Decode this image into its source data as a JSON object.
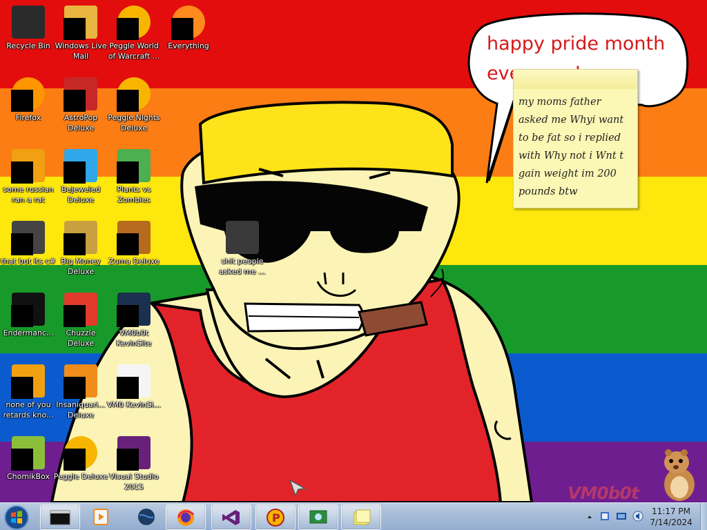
{
  "wallpaper": {
    "stripes": [
      "#e30d0d",
      "#fc7d14",
      "#fde70c",
      "#189a2a",
      "#0b5bcf",
      "#6e1e8e"
    ]
  },
  "speech_bubble": {
    "lines": [
      "happy pride month",
      "everyone!"
    ]
  },
  "sticky_note": {
    "lines": [
      "my moms father",
      "asked me Whyi want",
      "to be fat so i replied",
      "with Why not i Wnt t",
      "gain weight im 200",
      "pounds btw"
    ]
  },
  "desktop_icons": [
    {
      "label": "Recycle Bin",
      "icon": "recycle-bin-icon",
      "redacted": false
    },
    {
      "label": "Windows Live Mail",
      "icon": "mail-icon",
      "redacted": true
    },
    {
      "label": "Peggle World of Warcraft ...",
      "icon": "peggle-icon",
      "redacted": true
    },
    {
      "label": "Everything",
      "icon": "search-icon",
      "redacted": true
    },
    {
      "label": "Firefox",
      "icon": "firefox-icon",
      "redacted": true
    },
    {
      "label": "AstroPop Deluxe",
      "icon": "game-icon",
      "redacted": true
    },
    {
      "label": "Peggle Nights Deluxe",
      "icon": "peggle-icon",
      "redacted": true
    },
    {
      "label": "some russian ran a rat",
      "icon": "app-icon",
      "redacted": true
    },
    {
      "label": "Bejeweled Deluxe",
      "icon": "gem-icon",
      "redacted": true
    },
    {
      "label": "Plants vs Zombies",
      "icon": "plant-icon",
      "redacted": true
    },
    {
      "label": "that but its c#",
      "icon": "window-icon",
      "redacted": true
    },
    {
      "label": "Big Money Deluxe",
      "icon": "money-icon",
      "redacted": true
    },
    {
      "label": "Zuma Deluxe",
      "icon": "zuma-icon",
      "redacted": true
    },
    {
      "label": "Endermanc...",
      "icon": "terminal-icon",
      "redacted": true
    },
    {
      "label": "Chuzzle Deluxe",
      "icon": "chuzzle-icon",
      "redacted": true
    },
    {
      "label": "VM0b0t KevinSite",
      "icon": "shortcut-icon",
      "redacted": true
    },
    {
      "label": "none of you retards kno...",
      "icon": "app-icon",
      "redacted": true
    },
    {
      "label": "Insaniquari... Deluxe",
      "icon": "fish-icon",
      "redacted": true
    },
    {
      "label": "VM0 KevinSi...",
      "icon": "document-icon",
      "redacted": true
    },
    {
      "label": "ChomikBox",
      "icon": "hamster-icon",
      "redacted": true
    },
    {
      "label": "Peggle Deluxe",
      "icon": "peggle-icon",
      "redacted": true
    },
    {
      "label": "Visual Studio 2015",
      "icon": "visual-studio-icon",
      "redacted": true
    },
    {
      "label": "shit people asked me ...",
      "icon": "folder-icon",
      "redacted": false
    }
  ],
  "watermark": "VM0b0t",
  "taskbar": {
    "buttons": [
      {
        "name": "start-button",
        "icon": "windows-logo-icon"
      },
      {
        "name": "cmd-taskbar-button",
        "icon": "terminal-icon"
      },
      {
        "name": "media-player-taskbar-button",
        "icon": "media-player-icon"
      },
      {
        "name": "globe-taskbar-button",
        "icon": "globe-icon"
      },
      {
        "name": "firefox-taskbar-button",
        "icon": "firefox-icon"
      },
      {
        "name": "visual-studio-taskbar-button",
        "icon": "visual-studio-icon"
      },
      {
        "name": "peggle-taskbar-button",
        "icon": "peggle-icon"
      },
      {
        "name": "network-taskbar-button",
        "icon": "network-icon"
      },
      {
        "name": "sticky-notes-taskbar-button",
        "icon": "sticky-notes-icon"
      }
    ],
    "clock": {
      "time": "11:17 PM",
      "date": "7/14/2024"
    }
  }
}
